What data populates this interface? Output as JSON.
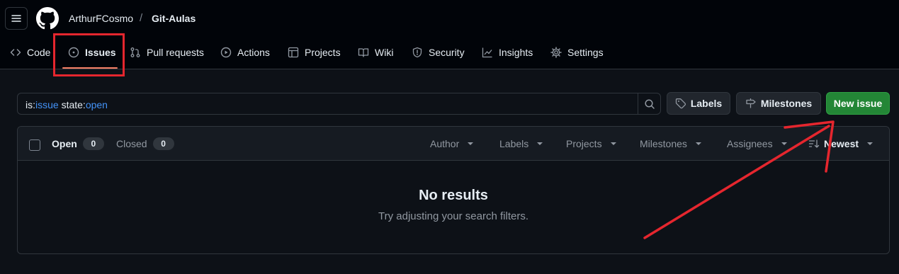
{
  "header": {
    "owner": "ArthurFCosmo",
    "separator": "/",
    "repo": "Git-Aulas"
  },
  "tabs": [
    {
      "label": "Code",
      "icon": "code-icon"
    },
    {
      "label": "Issues",
      "icon": "issue-opened-icon",
      "active": true
    },
    {
      "label": "Pull requests",
      "icon": "git-pull-request-icon"
    },
    {
      "label": "Actions",
      "icon": "play-icon"
    },
    {
      "label": "Projects",
      "icon": "table-icon"
    },
    {
      "label": "Wiki",
      "icon": "book-icon"
    },
    {
      "label": "Security",
      "icon": "shield-icon"
    },
    {
      "label": "Insights",
      "icon": "graph-icon"
    },
    {
      "label": "Settings",
      "icon": "gear-icon"
    }
  ],
  "search": {
    "prefix1": "is:",
    "value1": "issue",
    "prefix2": " state:",
    "value2": "open"
  },
  "actions": {
    "labels": "Labels",
    "milestones": "Milestones",
    "new_issue": "New issue"
  },
  "list": {
    "open_label": "Open",
    "open_count": "0",
    "closed_label": "Closed",
    "closed_count": "0",
    "filters": {
      "author": "Author",
      "labels": "Labels",
      "projects": "Projects",
      "milestones": "Milestones",
      "assignees": "Assignees",
      "sort": "Newest"
    }
  },
  "empty": {
    "title": "No results",
    "subtitle": "Try adjusting your search filters."
  },
  "colors": {
    "background": "#0d1117",
    "header": "#010409",
    "accent_underline": "#f78166",
    "primary_button": "#238636",
    "link": "#4493f8",
    "annotation": "#e5262e"
  }
}
